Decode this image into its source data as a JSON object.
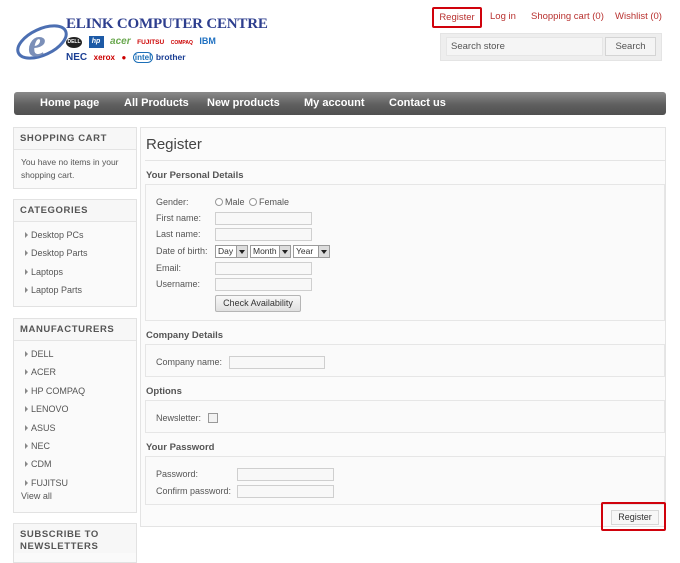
{
  "logo": {
    "title": "ELINK COMPUTER CENTRE",
    "brands_row1": [
      "DELL",
      "hp",
      "acer",
      "FUJITSU",
      "COMPAQ",
      "IBM"
    ],
    "brands_row2": [
      "NEC",
      "xerox",
      "intel",
      "brother"
    ]
  },
  "header": {
    "register": "Register",
    "login": "Log in",
    "cart": "Shopping cart (0)",
    "wishlist": "Wishlist (0)"
  },
  "search": {
    "placeholder": "Search store",
    "button": "Search"
  },
  "nav": [
    "Home page",
    "All Products",
    "New products",
    "My account",
    "Contact us"
  ],
  "sidebar": {
    "cart": {
      "title": "SHOPPING CART",
      "text": "You have no items in your shopping cart."
    },
    "categories": {
      "title": "CATEGORIES",
      "items": [
        "Desktop PCs",
        "Desktop Parts",
        "Laptops",
        "Laptop Parts"
      ]
    },
    "manufacturers": {
      "title": "MANUFACTURERS",
      "items": [
        "DELL",
        "ACER",
        "HP COMPAQ",
        "LENOVO",
        "ASUS",
        "NEC",
        "CDM",
        "FUJITSU"
      ],
      "view_all": "View all"
    },
    "newsletter": {
      "title_line1": "SUBSCRIBE TO",
      "title_line2": "NEWSLETTERS"
    }
  },
  "form": {
    "title": "Register",
    "personal": {
      "title": "Your Personal Details",
      "gender_label": "Gender:",
      "male": "Male",
      "female": "Female",
      "first_name": "First name:",
      "last_name": "Last name:",
      "dob": "Date of birth:",
      "day": "Day",
      "month": "Month",
      "year": "Year",
      "email": "Email:",
      "username": "Username:",
      "check_button": "Check Availability"
    },
    "company": {
      "title": "Company Details",
      "company_name": "Company name:"
    },
    "options": {
      "title": "Options",
      "newsletter": "Newsletter:"
    },
    "password": {
      "title": "Your Password",
      "password": "Password:",
      "confirm": "Confirm password:"
    },
    "register_button": "Register"
  }
}
